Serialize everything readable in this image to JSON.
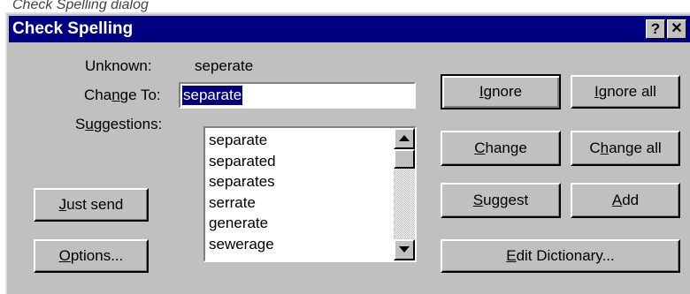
{
  "caption": "Check Spelling dialog",
  "dialog": {
    "title": "Check Spelling",
    "help_glyph": "?",
    "close_glyph": "✕"
  },
  "labels": {
    "unknown_label": "Unknown:",
    "unknown_word": "seperate",
    "change_to_pre": "Cha",
    "change_to_key": "n",
    "change_to_post": "ge To:",
    "suggestions_pre": "S",
    "suggestions_key": "u",
    "suggestions_post": "ggestions:"
  },
  "change_to_value": "separate",
  "suggestions": [
    "separate",
    "separated",
    "separates",
    "serrate",
    "generate",
    "sewerage"
  ],
  "buttons": {
    "ignore": {
      "key": "I",
      "rest": "gnore"
    },
    "ignore_all": {
      "key": "I",
      "rest": "gnore all"
    },
    "change": {
      "key": "C",
      "rest": "hange"
    },
    "change_all": {
      "pre": "C",
      "key": "h",
      "rest": "ange all"
    },
    "suggest": {
      "key": "S",
      "rest": "uggest"
    },
    "add": {
      "key": "A",
      "rest": "dd"
    },
    "edit_dictionary": {
      "key": "E",
      "rest": "dit Dictionary..."
    },
    "just_send": {
      "key": "J",
      "rest": "ust send"
    },
    "options": {
      "key": "O",
      "rest": "ptions..."
    }
  },
  "icons": {
    "scroll_up": "up-arrow-icon",
    "scroll_down": "down-arrow-icon"
  },
  "colors": {
    "titlebar": "#000080",
    "face": "#c0c0c0",
    "selection": "#000080"
  }
}
